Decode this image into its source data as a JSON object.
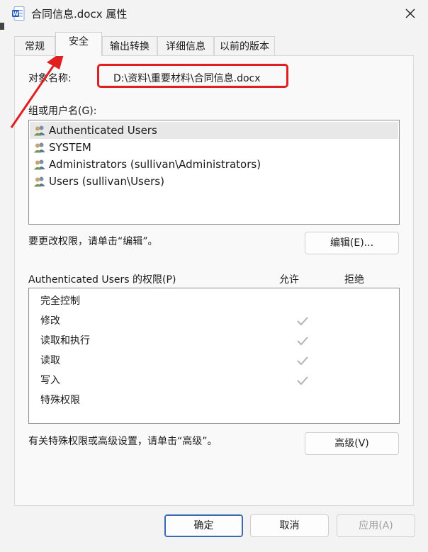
{
  "window": {
    "title": "合同信息.docx 属性",
    "app_icon": "word-doc-icon",
    "close_icon": "close-icon"
  },
  "tabs": [
    {
      "label": "常规",
      "active": false
    },
    {
      "label": "安全",
      "active": true
    },
    {
      "label": "输出转换",
      "active": false
    },
    {
      "label": "详细信息",
      "active": false
    },
    {
      "label": "以前的版本",
      "active": false
    }
  ],
  "security": {
    "object_name_label": "对象名称:",
    "object_name_value": "D:\\资料\\重要材料\\合同信息.docx",
    "group_label": "组或用户名(G):",
    "users": [
      {
        "name": "Authenticated Users",
        "selected": true
      },
      {
        "name": "SYSTEM",
        "selected": false
      },
      {
        "name": "Administrators (sullivan\\Administrators)",
        "selected": false
      },
      {
        "name": "Users (sullivan\\Users)",
        "selected": false
      }
    ],
    "change_hint": "要更改权限，请单击“编辑”。",
    "edit_button": "编辑(E)...",
    "perm_label": "Authenticated Users 的权限(P)",
    "allow_header": "允许",
    "deny_header": "拒绝",
    "permissions": [
      {
        "name": "完全控制",
        "allow": false
      },
      {
        "name": "修改",
        "allow": true
      },
      {
        "name": "读取和执行",
        "allow": true
      },
      {
        "name": "读取",
        "allow": true
      },
      {
        "name": "写入",
        "allow": true
      },
      {
        "name": "特殊权限",
        "allow": false
      }
    ],
    "advanced_hint": "有关特殊权限或高级设置，请单击“高级”。",
    "advanced_button": "高级(V)"
  },
  "footer": {
    "ok": "确定",
    "cancel": "取消",
    "apply": "应用(A)"
  },
  "colors": {
    "highlight_red": "#e02020",
    "primary_border": "#3c6ab2"
  }
}
